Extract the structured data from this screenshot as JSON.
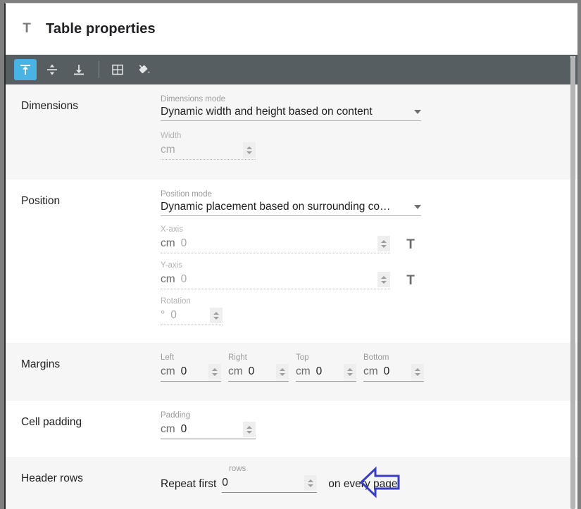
{
  "window": {
    "title": "Table properties",
    "title_icon": "text-T-icon"
  },
  "toolbar": {
    "items": [
      {
        "name": "align-top-icon",
        "label": "Align top",
        "active": true
      },
      {
        "name": "align-middle-icon",
        "label": "Align middle",
        "active": false
      },
      {
        "name": "align-bottom-icon",
        "label": "Align bottom",
        "active": false
      },
      {
        "name": "table-borders-icon",
        "label": "Table borders",
        "active": false
      },
      {
        "name": "fill-color-icon",
        "label": "Fill color",
        "active": false
      }
    ]
  },
  "sections": {
    "dimensions": {
      "label": "Dimensions",
      "mode_label": "Dimensions mode",
      "mode_value": "Dynamic width and height based on content",
      "width_label": "Width",
      "width_unit": "cm",
      "width_value": ""
    },
    "position": {
      "label": "Position",
      "mode_label": "Position mode",
      "mode_value": "Dynamic placement based on surrounding co…",
      "x_label": "X-axis",
      "x_unit": "cm",
      "x_value": "0",
      "y_label": "Y-axis",
      "y_unit": "cm",
      "y_value": "0",
      "rotation_label": "Rotation",
      "rotation_unit": "°",
      "rotation_value": "0",
      "text_button": "T"
    },
    "margins": {
      "label": "Margins",
      "fields": [
        {
          "label": "Left",
          "unit": "cm",
          "value": "0"
        },
        {
          "label": "Right",
          "unit": "cm",
          "value": "0"
        },
        {
          "label": "Top",
          "unit": "cm",
          "value": "0"
        },
        {
          "label": "Bottom",
          "unit": "cm",
          "value": "0"
        }
      ]
    },
    "cell_padding": {
      "label": "Cell padding",
      "padding_label": "Padding",
      "padding_unit": "cm",
      "padding_value": "0"
    },
    "header_rows": {
      "label": "Header rows",
      "rows_label": "rows",
      "lead_text": "Repeat first",
      "rows_value": "0",
      "trail_text": "on every page"
    }
  },
  "annotation": {
    "shape": "left-arrow-callout",
    "color": "#3a3ec4"
  },
  "colors": {
    "toolbar_bg": "#565e62",
    "toolbar_active": "#49b3e4",
    "section_shade": "#f6f6f6",
    "text_primary": "#202124",
    "text_muted": "#9b9b9b"
  }
}
